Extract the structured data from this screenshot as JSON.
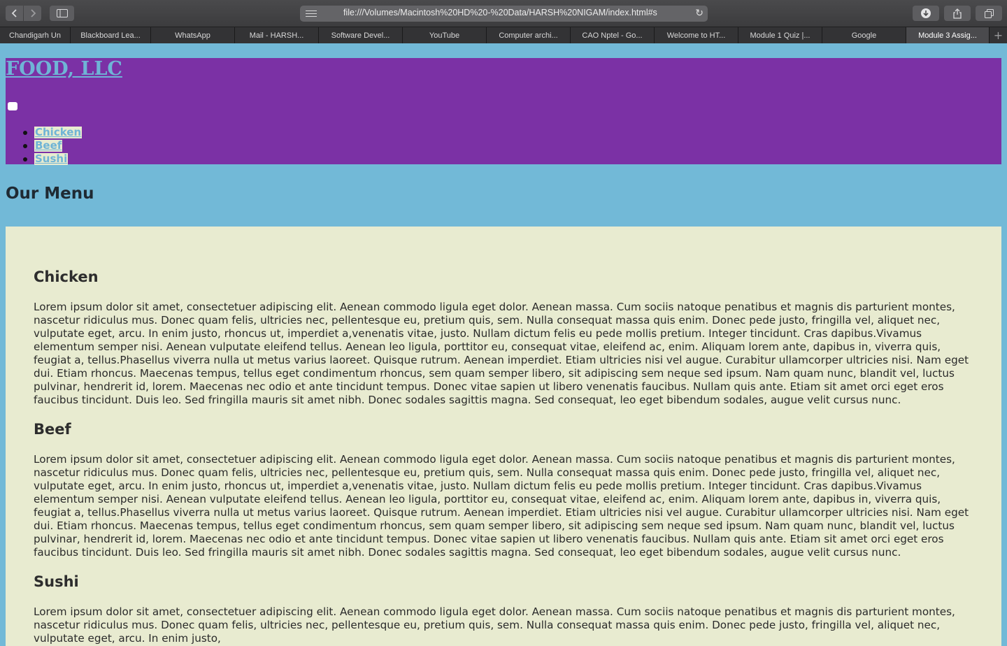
{
  "browser": {
    "url": "file:///Volumes/Macintosh%20HD%20-%20Data/HARSH%20NIGAM/index.html#s",
    "tabs": [
      {
        "label": "Chandigarh Un"
      },
      {
        "label": "Blackboard Lea..."
      },
      {
        "label": "WhatsApp"
      },
      {
        "label": "Mail - HARSH..."
      },
      {
        "label": "Software Devel..."
      },
      {
        "label": "YouTube"
      },
      {
        "label": "Computer archi..."
      },
      {
        "label": "CAO Nptel - Go..."
      },
      {
        "label": "Welcome to HT..."
      },
      {
        "label": "Module 1 Quiz |..."
      },
      {
        "label": "Google"
      },
      {
        "label": "Module 3 Assig..."
      }
    ],
    "active_tab_index": 11,
    "icons": {
      "back": "chevron-left-icon",
      "forward": "chevron-right-icon",
      "sidebar": "sidebar-icon",
      "reader": "reader-icon",
      "reload": "reload-icon",
      "downloads": "download-icon",
      "share": "share-icon",
      "tab_overview": "tab-overview-icon",
      "new_tab": "plus-icon"
    }
  },
  "site": {
    "brand": "FOOD, LLC",
    "nav": [
      {
        "label": "Chicken"
      },
      {
        "label": "Beef"
      },
      {
        "label": "Sushi"
      }
    ],
    "menu_heading": "Our Menu",
    "sections": [
      {
        "title": "Chicken",
        "body": "Lorem ipsum dolor sit amet, consectetuer adipiscing elit. Aenean commodo ligula eget dolor. Aenean massa. Cum sociis natoque penatibus et magnis dis parturient montes, nascetur ridiculus mus. Donec quam felis, ultricies nec, pellentesque eu, pretium quis, sem. Nulla consequat massa quis enim. Donec pede justo, fringilla vel, aliquet nec, vulputate eget, arcu. In enim justo, rhoncus ut, imperdiet a,venenatis vitae, justo. Nullam dictum felis eu pede mollis pretium. Integer tincidunt. Cras dapibus.Vivamus elementum semper nisi. Aenean vulputate eleifend tellus. Aenean leo ligula, porttitor eu, consequat vitae, eleifend ac, enim. Aliquam lorem ante, dapibus in, viverra quis, feugiat a, tellus.Phasellus viverra nulla ut metus varius laoreet. Quisque rutrum. Aenean imperdiet. Etiam ultricies nisi vel augue. Curabitur ullamcorper ultricies nisi. Nam eget dui. Etiam rhoncus. Maecenas tempus, tellus eget condimentum rhoncus, sem quam semper libero, sit adipiscing sem neque sed ipsum. Nam quam nunc, blandit vel, luctus pulvinar, hendrerit id, lorem. Maecenas nec odio et ante tincidunt tempus. Donec vitae sapien ut libero venenatis faucibus. Nullam quis ante. Etiam sit amet orci eget eros faucibus tincidunt. Duis leo. Sed fringilla mauris sit amet nibh. Donec sodales sagittis magna. Sed consequat, leo eget bibendum sodales, augue velit cursus nunc."
      },
      {
        "title": "Beef",
        "body": "Lorem ipsum dolor sit amet, consectetuer adipiscing elit. Aenean commodo ligula eget dolor. Aenean massa. Cum sociis natoque penatibus et magnis dis parturient montes, nascetur ridiculus mus. Donec quam felis, ultricies nec, pellentesque eu, pretium quis, sem. Nulla consequat massa quis enim. Donec pede justo, fringilla vel, aliquet nec, vulputate eget, arcu. In enim justo, rhoncus ut, imperdiet a,venenatis vitae, justo. Nullam dictum felis eu pede mollis pretium. Integer tincidunt. Cras dapibus.Vivamus elementum semper nisi. Aenean vulputate eleifend tellus. Aenean leo ligula, porttitor eu, consequat vitae, eleifend ac, enim. Aliquam lorem ante, dapibus in, viverra quis, feugiat a, tellus.Phasellus viverra nulla ut metus varius laoreet. Quisque rutrum. Aenean imperdiet. Etiam ultricies nisi vel augue. Curabitur ullamcorper ultricies nisi. Nam eget dui. Etiam rhoncus. Maecenas tempus, tellus eget condimentum rhoncus, sem quam semper libero, sit adipiscing sem neque sed ipsum. Nam quam nunc, blandit vel, luctus pulvinar, hendrerit id, lorem. Maecenas nec odio et ante tincidunt tempus. Donec vitae sapien ut libero venenatis faucibus. Nullam quis ante. Etiam sit amet orci eget eros faucibus tincidunt. Duis leo. Sed fringilla mauris sit amet nibh. Donec sodales sagittis magna. Sed consequat, leo eget bibendum sodales, augue velit cursus nunc."
      },
      {
        "title": "Sushi",
        "body": "Lorem ipsum dolor sit amet, consectetuer adipiscing elit. Aenean commodo ligula eget dolor. Aenean massa. Cum sociis natoque penatibus et magnis dis parturient montes, nascetur ridiculus mus. Donec quam felis, ultricies nec, pellentesque eu, pretium quis, sem. Nulla consequat massa quis enim. Donec pede justo, fringilla vel, aliquet nec, vulputate eget, arcu. In enim justo,"
      }
    ]
  },
  "colors": {
    "page_background": "#72b9d7",
    "header_background": "#7b31a5",
    "brand_text": "#6fb4d6",
    "panel_background": "#e8ebd0",
    "heading_text": "#2d2d2d"
  }
}
